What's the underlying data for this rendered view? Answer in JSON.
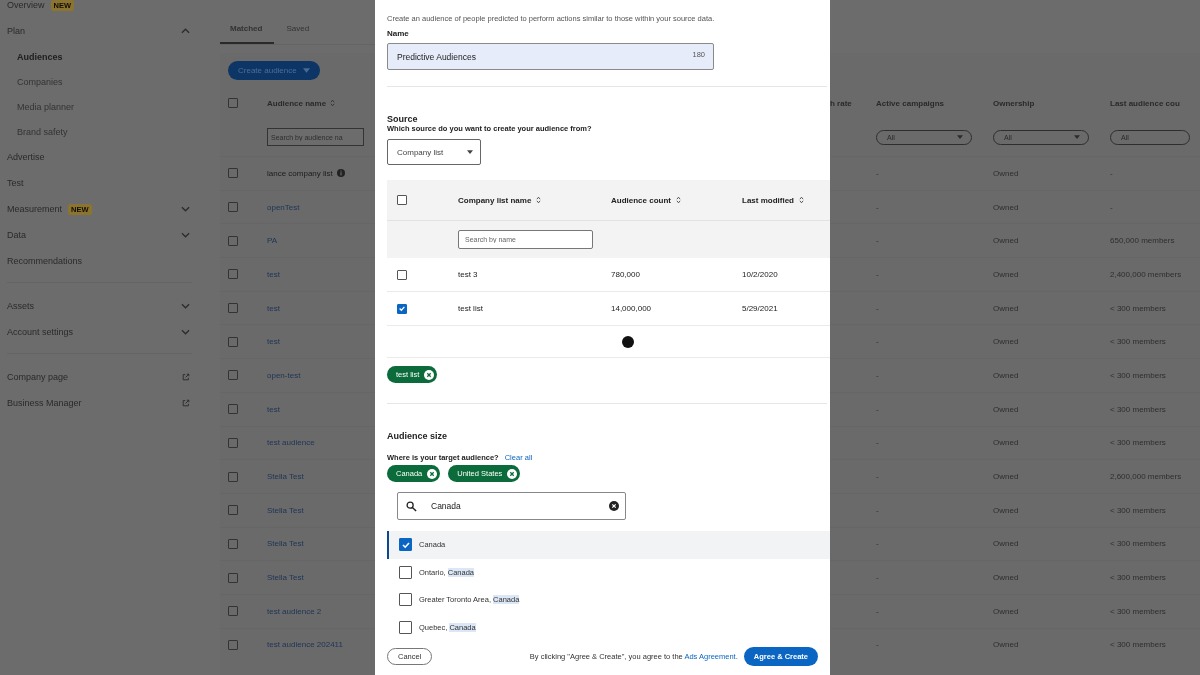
{
  "sidebar": {
    "sections": [
      [
        {
          "label": "Overview",
          "badge": "NEW",
          "kind": "link"
        },
        {
          "label": "Plan",
          "kind": "group",
          "expanded": true,
          "children": [
            {
              "label": "Audiences",
              "selected": true
            },
            {
              "label": "Companies",
              "selected": false
            },
            {
              "label": "Media planner",
              "selected": false
            },
            {
              "label": "Brand safety",
              "selected": false
            }
          ]
        },
        {
          "label": "Advertise",
          "kind": "link"
        },
        {
          "label": "Test",
          "kind": "link"
        },
        {
          "label": "Measurement",
          "badge": "NEW",
          "kind": "group",
          "expanded": false
        },
        {
          "label": "Data",
          "kind": "group",
          "expanded": false
        },
        {
          "label": "Recommendations",
          "kind": "link"
        }
      ],
      [
        {
          "label": "Assets",
          "kind": "group",
          "expanded": false
        },
        {
          "label": "Account settings",
          "kind": "group",
          "expanded": false
        }
      ],
      [
        {
          "label": "Company page",
          "kind": "external"
        },
        {
          "label": "Business Manager",
          "kind": "external"
        }
      ]
    ]
  },
  "tabs": [
    {
      "label": "Matched",
      "selected": true
    },
    {
      "label": "Saved",
      "selected": false
    }
  ],
  "create_button": "Create audience",
  "table": {
    "columns": [
      "Audience name",
      "h rate",
      "Active campaigns",
      "Ownership",
      "Last audience cou"
    ],
    "all_checked": false,
    "search_placeholder": "Search by audience na",
    "filters": [
      "All",
      "All",
      "All"
    ],
    "rows": [
      {
        "checked": false,
        "name": "lance company list",
        "link": false,
        "info": true,
        "active": "-",
        "ownership": "Owned",
        "count": "-"
      },
      {
        "checked": false,
        "name": "openTest",
        "link": true,
        "info": false,
        "active": "-",
        "ownership": "Owned",
        "count": "-"
      },
      {
        "checked": false,
        "name": "PA",
        "link": true,
        "info": false,
        "active": "-",
        "ownership": "Owned",
        "count": "650,000 members"
      },
      {
        "checked": false,
        "name": "test",
        "link": true,
        "info": false,
        "active": "-",
        "ownership": "Owned",
        "count": "2,400,000 members"
      },
      {
        "checked": false,
        "name": "test",
        "link": true,
        "info": false,
        "active": "-",
        "ownership": "Owned",
        "count": "< 300 members"
      },
      {
        "checked": false,
        "name": "test",
        "link": true,
        "info": false,
        "active": "-",
        "ownership": "Owned",
        "count": "< 300 members"
      },
      {
        "checked": false,
        "name": "open-test",
        "link": true,
        "info": false,
        "active": "-",
        "ownership": "Owned",
        "count": "< 300 members"
      },
      {
        "checked": false,
        "name": "test",
        "link": true,
        "info": false,
        "active": "-",
        "ownership": "Owned",
        "count": "< 300 members"
      },
      {
        "checked": false,
        "name": "test audience",
        "link": true,
        "info": false,
        "active": "-",
        "ownership": "Owned",
        "count": "< 300 members"
      },
      {
        "checked": false,
        "name": "Stella Test",
        "link": true,
        "info": false,
        "active": "-",
        "ownership": "Owned",
        "count": "2,600,000 members"
      },
      {
        "checked": false,
        "name": "Stella Test",
        "link": true,
        "info": false,
        "active": "-",
        "ownership": "Owned",
        "count": "< 300 members"
      },
      {
        "checked": false,
        "name": "Stella Test",
        "link": true,
        "info": false,
        "active": "-",
        "ownership": "Owned",
        "count": "< 300 members"
      },
      {
        "checked": false,
        "name": "Stella Test",
        "link": true,
        "info": false,
        "active": "-",
        "ownership": "Owned",
        "count": "< 300 members"
      },
      {
        "checked": false,
        "name": "test audience 2",
        "link": true,
        "info": false,
        "active": "-",
        "ownership": "Owned",
        "count": "< 300 members"
      },
      {
        "checked": false,
        "name": "test audience 202411",
        "link": true,
        "info": false,
        "active": "-",
        "ownership": "Owned",
        "count": "< 300 members"
      }
    ]
  },
  "modal": {
    "description": "Create an audience of people predicted to perform actions similar to those within your source data.",
    "name_label": "Name",
    "name_value": "Predictive Audiences",
    "name_counter": "180",
    "source_title": "Source",
    "source_question": "Which source do you want to create your audience from?",
    "source_select": "Company list",
    "list_table": {
      "columns": [
        "Company list name",
        "Audience count",
        "Last modified"
      ],
      "all_checked": false,
      "search_placeholder": "Search by name",
      "rows": [
        {
          "name": "test 3",
          "count": "780,000",
          "modified": "10/2/2020",
          "checked": false
        },
        {
          "name": "test list",
          "count": "14,000,000",
          "modified": "5/29/2021",
          "checked": true
        }
      ]
    },
    "selected_lists": [
      "test list"
    ],
    "size_title": "Audience size",
    "location_question": "Where is your target audience?",
    "clear_all": "Clear all",
    "locations": [
      "Canada",
      "United States"
    ],
    "location_search": "Canada",
    "results": [
      {
        "checked": true,
        "selected": true,
        "parts": [
          {
            "text": "Canada",
            "highlighted": false
          }
        ]
      },
      {
        "checked": false,
        "selected": false,
        "parts": [
          {
            "text": "Ontario, ",
            "highlighted": false
          },
          {
            "text": "Canada",
            "highlighted": true
          }
        ]
      },
      {
        "checked": false,
        "selected": false,
        "parts": [
          {
            "text": "Greater Toronto Area, ",
            "highlighted": false
          },
          {
            "text": "Canada",
            "highlighted": true
          }
        ]
      },
      {
        "checked": false,
        "selected": false,
        "parts": [
          {
            "text": "Quebec, ",
            "highlighted": false
          },
          {
            "text": "Canada",
            "highlighted": true
          }
        ]
      }
    ],
    "cancel": "Cancel",
    "agreement_text": "By clicking \"Agree & Create\", you agree to the",
    "agreement_link": "Ads Agreement",
    "agreement_end": ".",
    "submit": "Agree & Create"
  }
}
